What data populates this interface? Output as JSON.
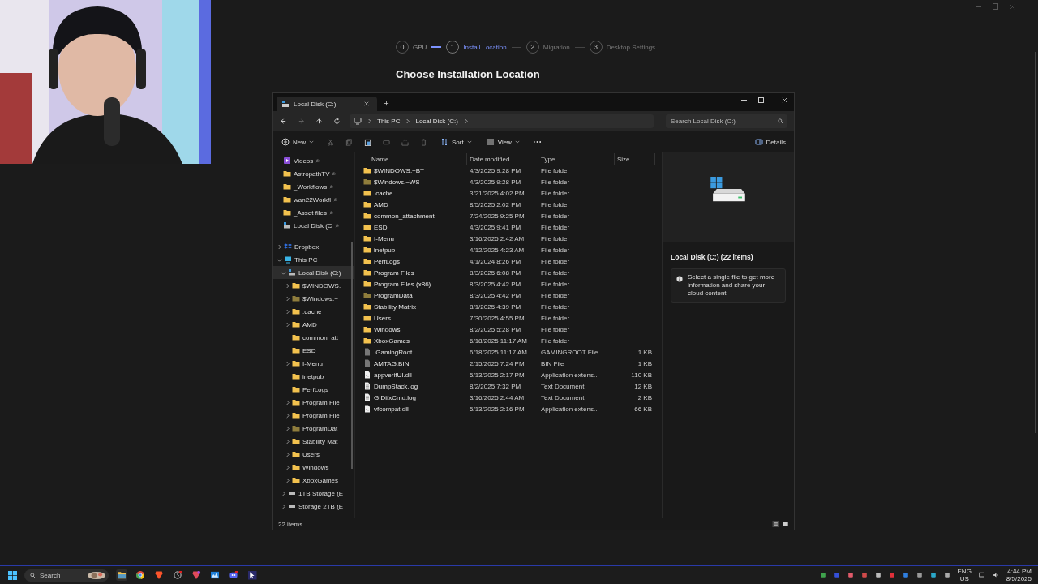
{
  "steps": [
    {
      "number": "0",
      "label": "GPU",
      "selected": false
    },
    {
      "number": "1",
      "label": "Install Location",
      "selected": true
    },
    {
      "number": "2",
      "label": "Migration",
      "selected": false
    },
    {
      "number": "3",
      "label": "Desktop Settings",
      "selected": false
    }
  ],
  "heading": "Choose Installation Location",
  "explorer": {
    "tab": "Local Disk (C:)",
    "breadcrumb": [
      "This PC",
      "Local Disk (C:)"
    ],
    "search": {
      "placeholder": "Search Local Disk (C:)"
    },
    "toolbar": {
      "new": "New",
      "sort": "Sort",
      "view": "View",
      "details": "Details"
    },
    "quick_access": [
      {
        "label": "Videos",
        "kind": "videos"
      },
      {
        "label": "AstropathTV",
        "kind": "folder"
      },
      {
        "label": "_Workflows",
        "kind": "folder"
      },
      {
        "label": "wan22Workfl",
        "kind": "folder"
      },
      {
        "label": "_Asset files",
        "kind": "folder"
      },
      {
        "label": "Local Disk (C",
        "kind": "drive"
      }
    ],
    "tree": [
      {
        "label": "Dropbox",
        "kind": "dropbox",
        "expanded": false,
        "selected": false
      },
      {
        "label": "This PC",
        "kind": "pc",
        "expanded": true,
        "selected": false,
        "children": [
          {
            "label": "Local Disk (C:)",
            "kind": "drive",
            "expanded": true,
            "selected": true,
            "children": [
              {
                "label": "$WINDOWS.",
                "kind": "folder",
                "expanded": false,
                "selected": false
              },
              {
                "label": "$Windows.~",
                "kind": "hidden_folder",
                "expanded": false,
                "selected": false
              },
              {
                "label": ".cache",
                "kind": "folder",
                "expanded": false,
                "selected": false
              },
              {
                "label": "AMD",
                "kind": "folder",
                "expanded": false,
                "selected": false
              },
              {
                "label": "common_att",
                "kind": "folder",
                "selected": false
              },
              {
                "label": "ESD",
                "kind": "folder",
                "selected": false
              },
              {
                "label": "I-Menu",
                "kind": "folder",
                "expanded": false,
                "selected": false
              },
              {
                "label": "inetpub",
                "kind": "folder",
                "selected": false
              },
              {
                "label": "PerfLogs",
                "kind": "folder",
                "selected": false
              },
              {
                "label": "Program File",
                "kind": "folder",
                "expanded": false,
                "selected": false
              },
              {
                "label": "Program File",
                "kind": "folder",
                "expanded": false,
                "selected": false
              },
              {
                "label": "ProgramDat",
                "kind": "hidden_folder",
                "expanded": false,
                "selected": false
              },
              {
                "label": "Stability Mat",
                "kind": "folder",
                "expanded": false,
                "selected": false
              },
              {
                "label": "Users",
                "kind": "folder",
                "expanded": false,
                "selected": false
              },
              {
                "label": "Windows",
                "kind": "folder",
                "expanded": false,
                "selected": false
              },
              {
                "label": "XboxGames",
                "kind": "folder",
                "expanded": false,
                "selected": false
              }
            ]
          },
          {
            "label": "1TB Storage (E",
            "kind": "disk",
            "expanded": false,
            "selected": false
          },
          {
            "label": "Storage 2TB (E",
            "kind": "disk",
            "expanded": false,
            "selected": false
          }
        ]
      }
    ],
    "columns": [
      "Name",
      "Date modified",
      "Type",
      "Size"
    ],
    "rows": [
      {
        "name": "$WINDOWS.~BT",
        "date": "4/3/2025 9:28 PM",
        "type": "File folder",
        "kind": "folder"
      },
      {
        "name": "$Windows.~WS",
        "date": "4/3/2025 9:28 PM",
        "type": "File folder",
        "kind": "hidden_folder"
      },
      {
        "name": ".cache",
        "date": "3/21/2025 4:02 PM",
        "type": "File folder",
        "kind": "folder"
      },
      {
        "name": "AMD",
        "date": "8/5/2025 2:02 PM",
        "type": "File folder",
        "kind": "folder"
      },
      {
        "name": "common_attachment",
        "date": "7/24/2025 9:25 PM",
        "type": "File folder",
        "kind": "folder"
      },
      {
        "name": "ESD",
        "date": "4/3/2025 9:41 PM",
        "type": "File folder",
        "kind": "folder"
      },
      {
        "name": "I-Menu",
        "date": "3/16/2025 2:42 AM",
        "type": "File folder",
        "kind": "folder"
      },
      {
        "name": "inetpub",
        "date": "4/12/2025 4:23 AM",
        "type": "File folder",
        "kind": "folder"
      },
      {
        "name": "PerfLogs",
        "date": "4/1/2024 8:26 PM",
        "type": "File folder",
        "kind": "folder"
      },
      {
        "name": "Program Files",
        "date": "8/3/2025 6:08 PM",
        "type": "File folder",
        "kind": "folder"
      },
      {
        "name": "Program Files (x86)",
        "date": "8/3/2025 4:42 PM",
        "type": "File folder",
        "kind": "folder"
      },
      {
        "name": "ProgramData",
        "date": "8/3/2025 4:42 PM",
        "type": "File folder",
        "kind": "hidden_folder"
      },
      {
        "name": "Stability Matrix",
        "date": "8/1/2025 4:39 PM",
        "type": "File folder",
        "kind": "folder"
      },
      {
        "name": "Users",
        "date": "7/30/2025 4:55 PM",
        "type": "File folder",
        "kind": "folder"
      },
      {
        "name": "Windows",
        "date": "8/2/2025 5:28 PM",
        "type": "File folder",
        "kind": "folder"
      },
      {
        "name": "XboxGames",
        "date": "6/18/2025 11:17 AM",
        "type": "File folder",
        "kind": "folder"
      },
      {
        "name": ".GamingRoot",
        "date": "6/18/2025 11:17 AM",
        "type": "GAMINGROOT File",
        "size": "1 KB",
        "kind": "file"
      },
      {
        "name": "AMTAG.BIN",
        "date": "2/15/2025 7:24 PM",
        "type": "BIN File",
        "size": "1 KB",
        "kind": "file"
      },
      {
        "name": "appverifUI.dll",
        "date": "5/13/2025 2:17 PM",
        "type": "Application extens...",
        "size": "110 KB",
        "kind": "dll"
      },
      {
        "name": "DumpStack.log",
        "date": "8/2/2025 7:32 PM",
        "type": "Text Document",
        "size": "12 KB",
        "kind": "doc"
      },
      {
        "name": "GIDifxCmd.log",
        "date": "3/16/2025 2:44 AM",
        "type": "Text Document",
        "size": "2 KB",
        "kind": "doc"
      },
      {
        "name": "vfcompat.dll",
        "date": "5/13/2025 2:16 PM",
        "type": "Application extens...",
        "size": "66 KB",
        "kind": "dll"
      }
    ],
    "status": "22 items",
    "details": {
      "title": "Local Disk (C:) (22 items)",
      "info": "Select a single file to get more information and share your cloud content."
    }
  },
  "taskbar": {
    "search": {
      "placeholder": "Search"
    },
    "language": [
      "ENG",
      "US"
    ],
    "time": "4:44 PM",
    "date": "8/5/2025"
  }
}
